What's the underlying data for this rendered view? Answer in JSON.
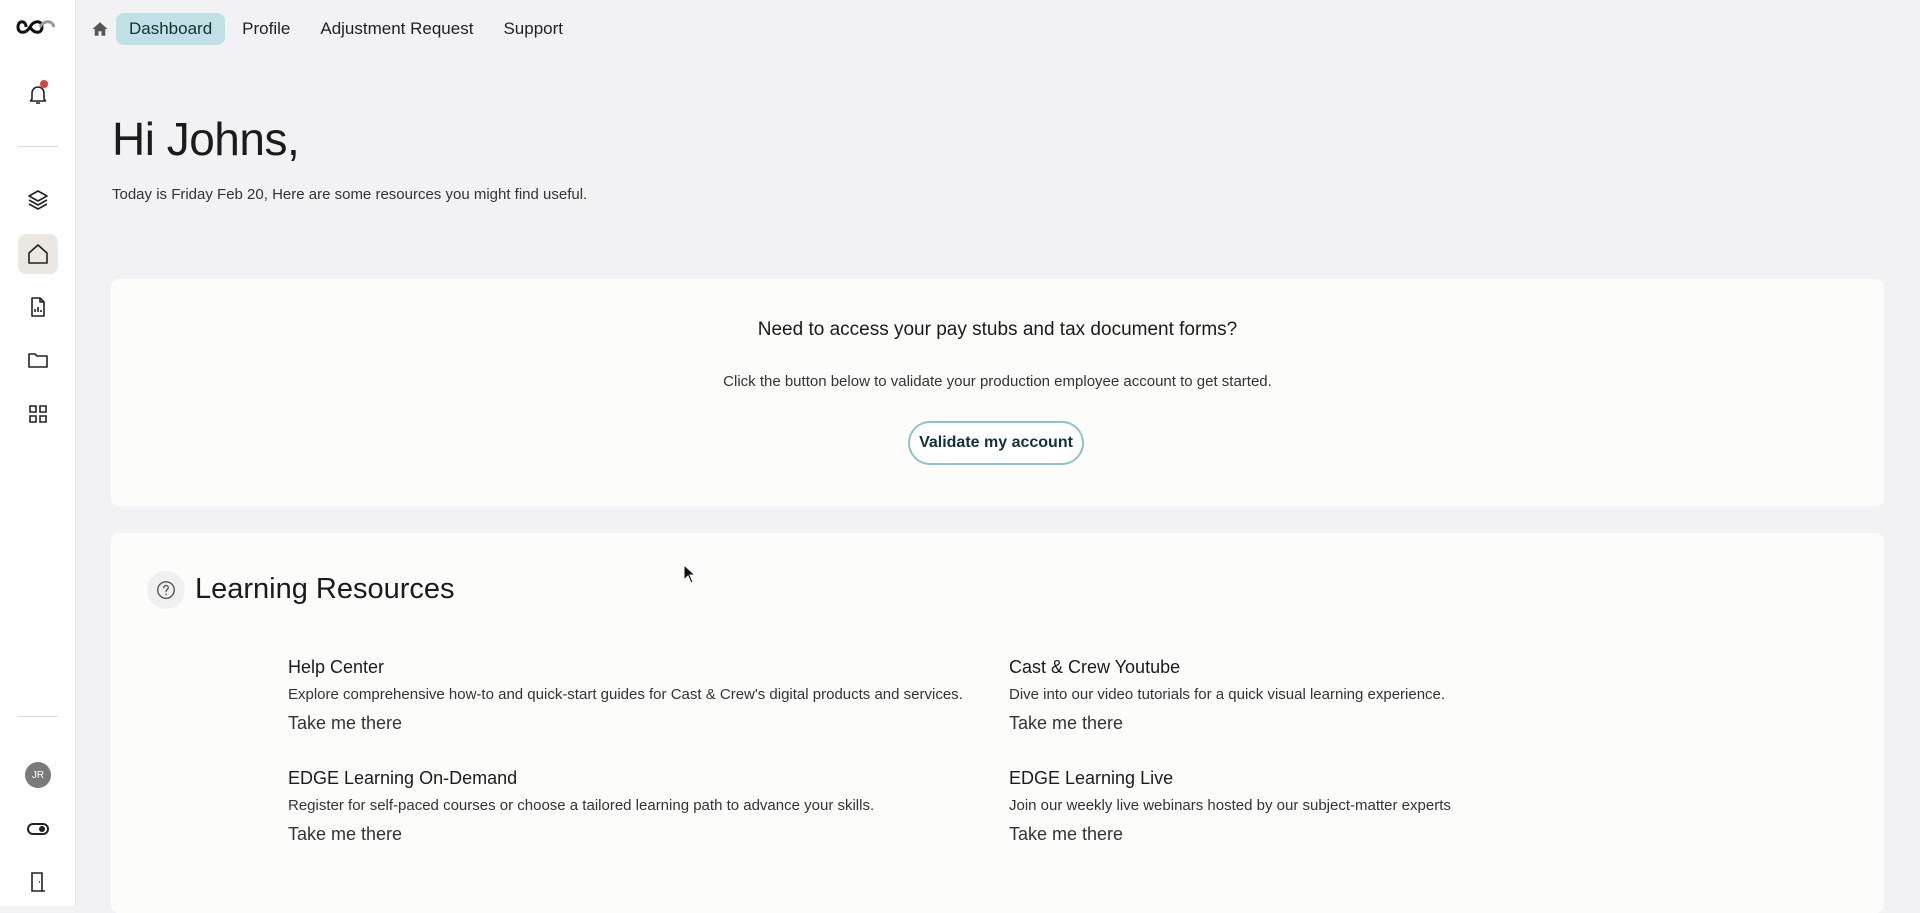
{
  "nav": {
    "items": [
      {
        "label": "Dashboard",
        "active": true
      },
      {
        "label": "Profile",
        "active": false
      },
      {
        "label": "Adjustment Request",
        "active": false
      },
      {
        "label": "Support",
        "active": false
      }
    ]
  },
  "sidebar": {
    "user_initials": "JR",
    "icons": [
      "logo-icon",
      "bell-icon",
      "layers-icon",
      "home-icon",
      "document-chart-icon",
      "folder-icon",
      "grid-icon",
      "avatar",
      "toggle-icon",
      "exit-door-icon"
    ]
  },
  "greeting": {
    "title": "Hi Johns,",
    "subtitle": "Today is Friday Feb 20, Here are some resources you might find useful."
  },
  "validate": {
    "title": "Need to access your pay stubs and tax document forms?",
    "description": "Click the button below to validate your production employee account to get started.",
    "button_label": "Validate my account"
  },
  "learning": {
    "title": "Learning Resources",
    "resources": [
      {
        "title": "Help Center",
        "description": "Explore comprehensive how-to and quick-start guides for Cast & Crew's digital products and services.",
        "link": "Take me there"
      },
      {
        "title": "Cast & Crew Youtube",
        "description": "Dive into our video tutorials for a quick visual learning experience.",
        "link": "Take me there"
      },
      {
        "title": "EDGE Learning On-Demand",
        "description": "Register for self-paced courses or choose a tailored learning path to advance your skills.",
        "link": "Take me there"
      },
      {
        "title": "EDGE Learning Live",
        "description": "Join our weekly live webinars hosted by our subject-matter experts",
        "link": "Take me there"
      }
    ]
  },
  "colors": {
    "accent": "#bfe0e4",
    "button_border": "#8fc3ca",
    "notification": "#d9413a",
    "background": "#f2f2f4"
  }
}
